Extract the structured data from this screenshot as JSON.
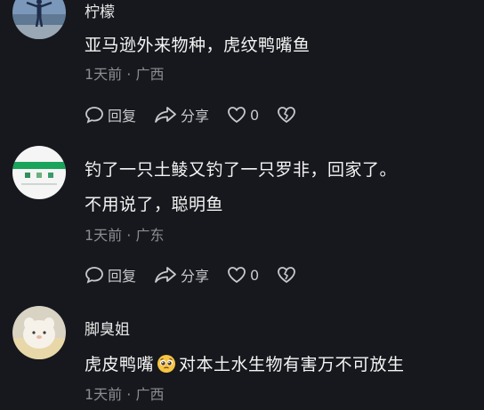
{
  "comments": [
    {
      "username": "柠檬",
      "lines": [
        "亚马逊外来物种，虎纹鸭嘴鱼"
      ],
      "meta": "1天前 · 广西",
      "reply_label": "回复",
      "share_label": "分享",
      "like_count": "0"
    },
    {
      "username": "",
      "lines": [
        "钓了一只土鲮又钓了一只罗非，回家了。",
        "不用说了，聪明鱼"
      ],
      "meta": "1天前 · 广东",
      "reply_label": "回复",
      "share_label": "分享",
      "like_count": "0"
    },
    {
      "username": "脚臭姐",
      "text_before_emoji": "虎皮鸭嘴",
      "emoji": "pleading-face-emoji",
      "text_after_emoji": "对本土水生物有害万不可放生",
      "meta": "1天前 · 广西"
    }
  ],
  "colors": {
    "background": "#16181d",
    "text": "#f4f4f4",
    "meta": "#8b8d93",
    "icon": "#c8c9cc"
  }
}
